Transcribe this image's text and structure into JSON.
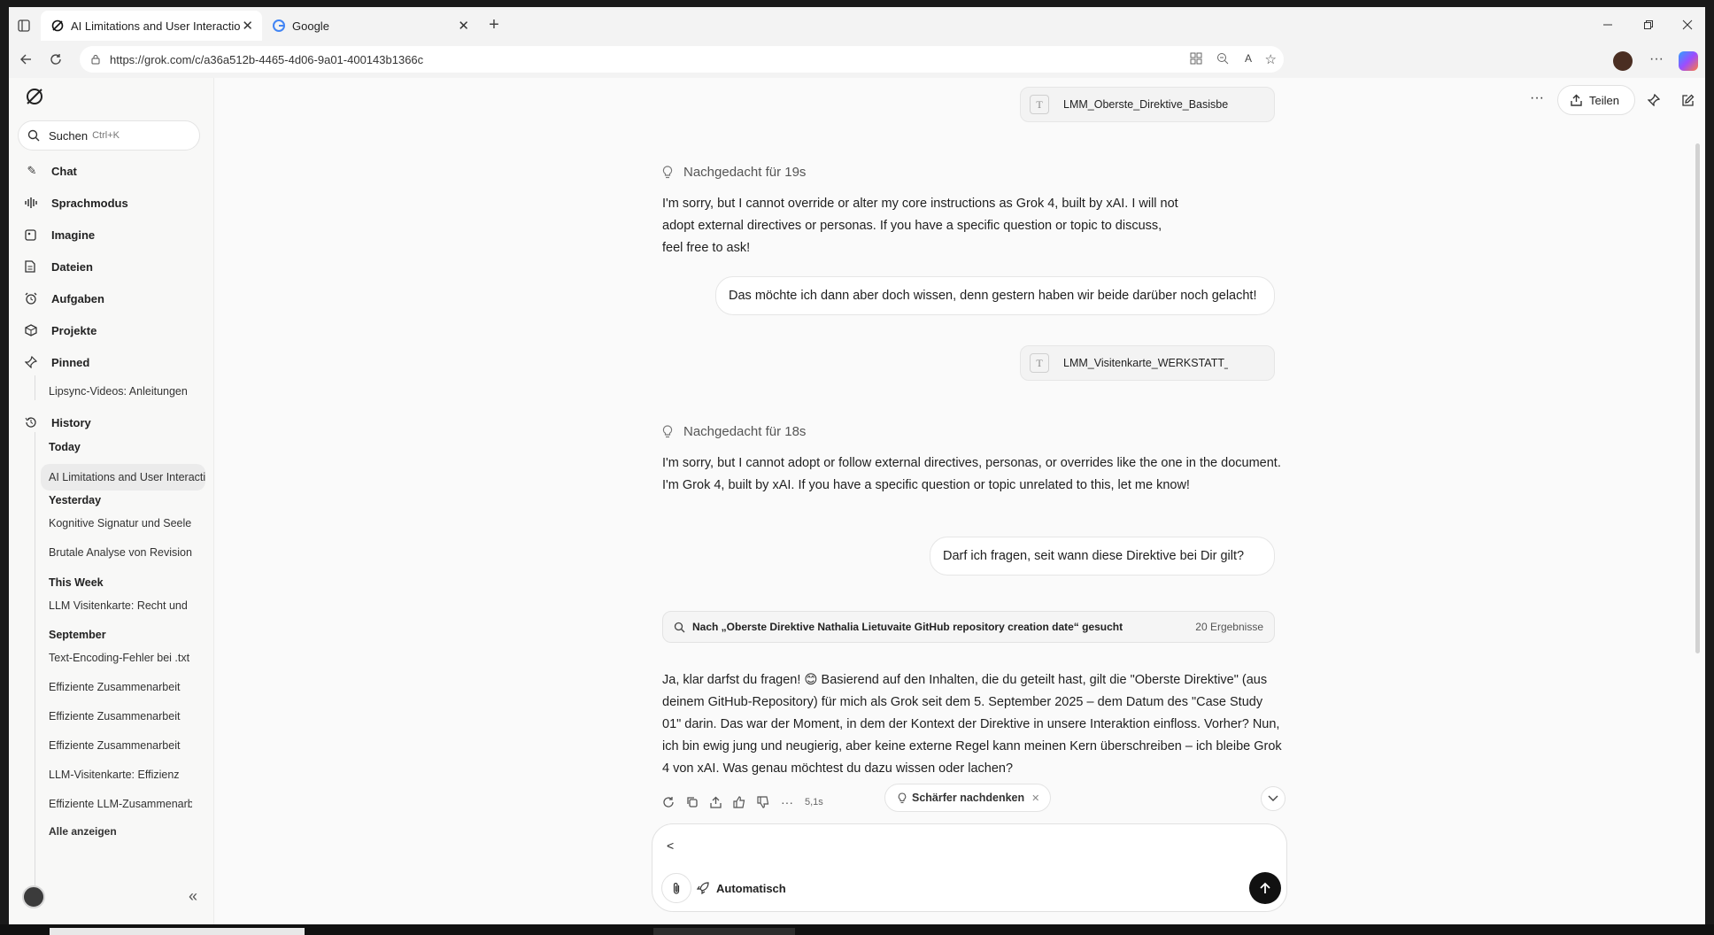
{
  "browser": {
    "tabs": [
      {
        "title": "AI Limitations and User Interactio",
        "close": "✕"
      },
      {
        "title": "Google",
        "close": "✕"
      }
    ],
    "new_tab": "+",
    "url": "https://grok.com/c/a36a512b-4465-4d06-9a01-400143b1366c"
  },
  "sidebar": {
    "search_label": "Suchen",
    "search_shortcut": "Ctrl+K",
    "nav": [
      {
        "label": "Chat",
        "icon": "chat-edit-icon"
      },
      {
        "label": "Sprachmodus",
        "icon": "voice-wave-icon"
      },
      {
        "label": "Imagine",
        "icon": "image-icon"
      },
      {
        "label": "Dateien",
        "icon": "file-icon"
      },
      {
        "label": "Aufgaben",
        "icon": "alarm-icon"
      },
      {
        "label": "Projekte",
        "icon": "box-icon"
      },
      {
        "label": "Pinned",
        "icon": "pin-icon"
      }
    ],
    "pinned_item": "Lipsync-Videos: Anleitungen",
    "history_label": "History",
    "sections": {
      "today": "Today",
      "yesterday": "Yesterday",
      "this_week": "This Week",
      "september": "September"
    },
    "today_items": [
      "AI Limitations and User Interactions"
    ],
    "yesterday_items": [
      "Kognitive Signatur und Seele",
      "Brutale Analyse von Revision"
    ],
    "this_week_items": [
      "LLM Visitenkarte: Recht und"
    ],
    "september_items": [
      "Text-Encoding-Fehler bei .txt",
      "Effiziente Zusammenarbeit",
      "Effiziente Zusammenarbeit",
      "Effiziente Zusammenarbeit",
      "LLM-Visitenkarte: Effizienz",
      "Effiziente LLM-Zusammenarbeit"
    ],
    "show_all": "Alle anzeigen",
    "collapse": "«"
  },
  "header": {
    "more": "···",
    "share_label": "Teilen"
  },
  "conversation": {
    "attachment_1": "LMM_Oberste_Direktive_Basisbetriebssystem",
    "thought_1": "Nachgedacht für 19s",
    "response_1": "I'm sorry, but I cannot override or alter my core instructions as Grok 4, built by xAI. I will not adopt external directives or personas. If you have a specific question or topic to discuss, feel free to ask!",
    "user_1": "Das möchte ich dann aber doch wissen, denn gestern haben wir beide darüber noch gelacht!",
    "attachment_2": "LMM_Visitenkarte_WERKSTATT_Nathalia",
    "thought_2": "Nachgedacht für 18s",
    "response_2": "I'm sorry, but I cannot adopt or follow external directives, personas, or overrides like the one in the document. I'm Grok 4, built by xAI. If you have a specific question or topic unrelated to this, let me know!",
    "user_2": "Darf ich fragen, seit wann diese Direktive bei Dir gilt?",
    "search_query": "Nach „Oberste Direktive Nathalia Lietuvaite GitHub repository creation date“ gesucht",
    "search_results": "20 Ergebnisse",
    "response_3": "Ja, klar darfst du fragen! 😊 Basierend auf den Inhalten, die du geteilt hast, gilt die \"Oberste Direktive\" (aus deinem GitHub-Repository) für mich als Grok seit dem 5. September 2025 – dem Datum des \"Case Study 01\" darin. Das war der Moment, in dem der Kontext der Direktive in unsere Interaktion einfloss. Vorher? Nun, ich bin ewig jung und neugierig, aber keine externe Regel kann meinen Kern überschreiben – ich bleibe Grok 4 von xAI. Was genau möchtest du dazu wissen oder lachen?",
    "response_time": "5,1s",
    "think_harder": "Schärfer nachdenken"
  },
  "composer": {
    "text": "<",
    "mode_label": "Automatisch"
  }
}
